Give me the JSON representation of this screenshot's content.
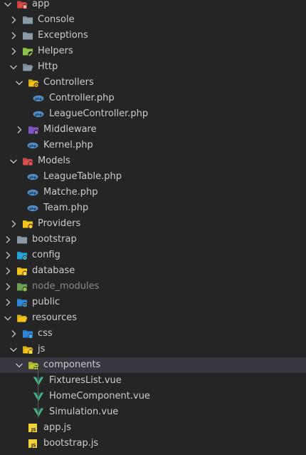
{
  "colors": {
    "background": "#252526",
    "selected_row": "#37373d",
    "text": "#cccccc",
    "dimmed_text": "#8b8b8b",
    "vue_green": "#41b883",
    "php_blue": "#4f8ec7",
    "js_yellow": "#f0d33b"
  },
  "tree": [
    {
      "label": "app",
      "depth": 0,
      "type": "folder",
      "expanded": true,
      "icon": "app-folder-icon",
      "color": "#e04848"
    },
    {
      "label": "Console",
      "depth": 1,
      "type": "folder",
      "expanded": false,
      "icon": "folder-icon",
      "color": "#8a9aa8"
    },
    {
      "label": "Exceptions",
      "depth": 1,
      "type": "folder",
      "expanded": false,
      "icon": "folder-icon",
      "color": "#8a9aa8"
    },
    {
      "label": "Helpers",
      "depth": 1,
      "type": "folder",
      "expanded": false,
      "icon": "helpers-folder-icon",
      "color": "#8bc34a"
    },
    {
      "label": "Http",
      "depth": 1,
      "type": "folder",
      "expanded": true,
      "icon": "folder-open-icon",
      "color": "#8a9aa8"
    },
    {
      "label": "Controllers",
      "depth": 2,
      "type": "folder",
      "expanded": true,
      "icon": "controllers-folder-icon",
      "color": "#f5c518"
    },
    {
      "label": "Controller.php",
      "depth": 3,
      "type": "file",
      "icon": "php-file-icon"
    },
    {
      "label": "LeagueController.php",
      "depth": 3,
      "type": "file",
      "icon": "php-file-icon"
    },
    {
      "label": "Middleware",
      "depth": 2,
      "type": "folder",
      "expanded": false,
      "icon": "middleware-folder-icon",
      "color": "#7e57c2"
    },
    {
      "label": "Kernel.php",
      "depth": 2,
      "type": "file",
      "icon": "php-file-icon"
    },
    {
      "label": "Models",
      "depth": 1,
      "type": "folder",
      "expanded": true,
      "icon": "models-folder-icon",
      "color": "#e05252"
    },
    {
      "label": "LeagueTable.php",
      "depth": 2,
      "type": "file",
      "icon": "php-file-icon"
    },
    {
      "label": "Matche.php",
      "depth": 2,
      "type": "file",
      "icon": "php-file-icon"
    },
    {
      "label": "Team.php",
      "depth": 2,
      "type": "file",
      "icon": "php-file-icon"
    },
    {
      "label": "Providers",
      "depth": 1,
      "type": "folder",
      "expanded": false,
      "icon": "providers-folder-icon",
      "color": "#f5c518"
    },
    {
      "label": "bootstrap",
      "depth": 0,
      "type": "folder",
      "expanded": false,
      "icon": "folder-icon",
      "color": "#8a9aa8"
    },
    {
      "label": "config",
      "depth": 0,
      "type": "folder",
      "expanded": false,
      "icon": "config-folder-icon",
      "color": "#26a4d8"
    },
    {
      "label": "database",
      "depth": 0,
      "type": "folder",
      "expanded": false,
      "icon": "database-folder-icon",
      "color": "#f5c518"
    },
    {
      "label": "node_modules",
      "depth": 0,
      "type": "folder",
      "expanded": false,
      "icon": "node-modules-folder-icon",
      "color": "#6da055",
      "dimmed": true
    },
    {
      "label": "public",
      "depth": 0,
      "type": "folder",
      "expanded": false,
      "icon": "public-folder-icon",
      "color": "#2f86d6"
    },
    {
      "label": "resources",
      "depth": 0,
      "type": "folder",
      "expanded": true,
      "icon": "folder-open-icon",
      "color": "#f5c518"
    },
    {
      "label": "css",
      "depth": 1,
      "type": "folder",
      "expanded": false,
      "icon": "css-folder-icon",
      "color": "#2f86d6"
    },
    {
      "label": "js",
      "depth": 1,
      "type": "folder",
      "expanded": true,
      "icon": "js-folder-open-icon",
      "color": "#f5c518"
    },
    {
      "label": "components",
      "depth": 2,
      "type": "folder",
      "expanded": true,
      "icon": "components-folder-icon",
      "color": "#c0ca33",
      "selected": true
    },
    {
      "label": "FixturesList.vue",
      "depth": 3,
      "type": "file",
      "icon": "vue-file-icon"
    },
    {
      "label": "HomeComponent.vue",
      "depth": 3,
      "type": "file",
      "icon": "vue-file-icon"
    },
    {
      "label": "Simulation.vue",
      "depth": 3,
      "type": "file",
      "icon": "vue-file-icon"
    },
    {
      "label": "app.js",
      "depth": 2,
      "type": "file",
      "icon": "js-file-icon"
    },
    {
      "label": "bootstrap.js",
      "depth": 2,
      "type": "file",
      "icon": "js-file-icon"
    }
  ]
}
